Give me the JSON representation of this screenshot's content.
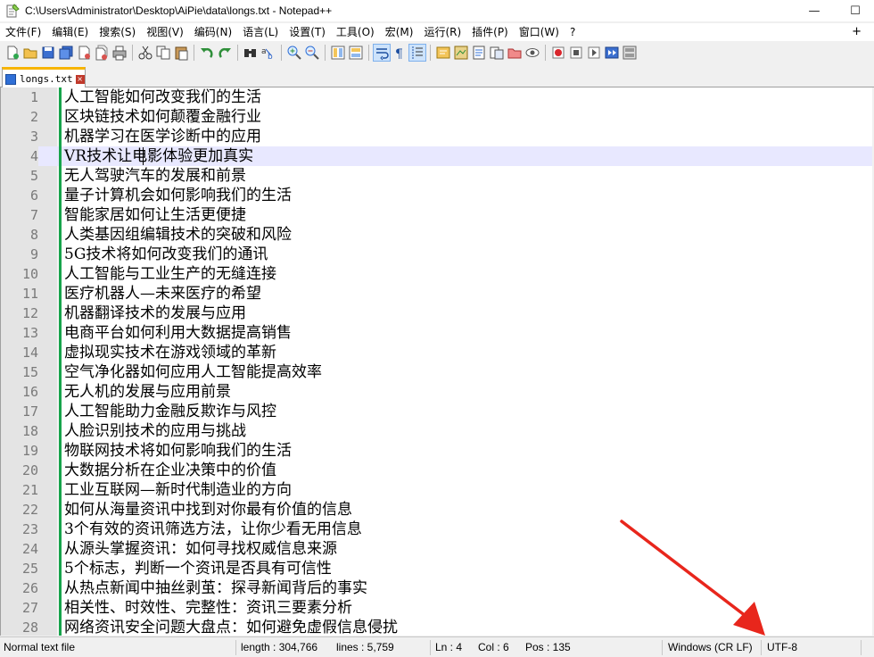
{
  "window": {
    "title": "C:\\Users\\Administrator\\Desktop\\AiPie\\data\\longs.txt - Notepad++",
    "minimize_glyph": "—",
    "maximize_glyph": "☐"
  },
  "menu": {
    "items": [
      "文件(F)",
      "编辑(E)",
      "搜索(S)",
      "视图(V)",
      "编码(N)",
      "语言(L)",
      "设置(T)",
      "工具(O)",
      "宏(M)",
      "运行(R)",
      "插件(P)",
      "窗口(W)",
      "?"
    ],
    "plus": "+"
  },
  "toolbar": {
    "icons": [
      "new-file-icon",
      "open-file-icon",
      "save-icon",
      "save-all-icon",
      "close-icon",
      "close-all-icon",
      "print-icon",
      "cut-icon",
      "copy-icon",
      "paste-icon",
      "undo-icon",
      "redo-icon",
      "find-icon",
      "replace-icon",
      "zoom-in-icon",
      "zoom-out-icon",
      "sync-vertical-icon",
      "sync-horizontal-icon",
      "word-wrap-icon",
      "show-all-chars-icon",
      "indent-guide-icon",
      "language-icon",
      "doc-map-icon",
      "function-list-icon",
      "folder-workspace-icon",
      "monitoring-icon",
      "record-macro-icon",
      "stop-macro-icon",
      "play-macro-icon",
      "run-macro-multiple-icon",
      "save-macro-icon"
    ]
  },
  "tab": {
    "label": "longs.txt",
    "close_glyph": "×"
  },
  "editor": {
    "current_line": 4,
    "lines": [
      {
        "n": "1",
        "text": "人工智能如何改变我们的生活"
      },
      {
        "n": "2",
        "text": "区块链技术如何颠覆金融行业"
      },
      {
        "n": "3",
        "text": "机器学习在医学诊断中的应用"
      },
      {
        "n": "4",
        "text": "VR技术让电影体验更加真实"
      },
      {
        "n": "5",
        "text": "无人驾驶汽车的发展和前景"
      },
      {
        "n": "6",
        "text": "量子计算机会如何影响我们的生活"
      },
      {
        "n": "7",
        "text": "智能家居如何让生活更便捷"
      },
      {
        "n": "8",
        "text": "人类基因组编辑技术的突破和风险"
      },
      {
        "n": "9",
        "text": "5G技术将如何改变我们的通讯"
      },
      {
        "n": "10",
        "text": "人工智能与工业生产的无缝连接"
      },
      {
        "n": "11",
        "text": "医疗机器人—未来医疗的希望"
      },
      {
        "n": "12",
        "text": "机器翻译技术的发展与应用"
      },
      {
        "n": "13",
        "text": "电商平台如何利用大数据提高销售"
      },
      {
        "n": "14",
        "text": "虚拟现实技术在游戏领域的革新"
      },
      {
        "n": "15",
        "text": "空气净化器如何应用人工智能提高效率"
      },
      {
        "n": "16",
        "text": "无人机的发展与应用前景"
      },
      {
        "n": "17",
        "text": "人工智能助力金融反欺诈与风控"
      },
      {
        "n": "18",
        "text": "人脸识别技术的应用与挑战"
      },
      {
        "n": "19",
        "text": "物联网技术将如何影响我们的生活"
      },
      {
        "n": "20",
        "text": "大数据分析在企业决策中的价值"
      },
      {
        "n": "21",
        "text": "工业互联网—新时代制造业的方向"
      },
      {
        "n": "22",
        "text": "如何从海量资讯中找到对你最有价值的信息"
      },
      {
        "n": "23",
        "text": "3个有效的资讯筛选方法，让你少看无用信息"
      },
      {
        "n": "24",
        "text": "从源头掌握资讯：如何寻找权威信息来源"
      },
      {
        "n": "25",
        "text": "5个标志，判断一个资讯是否具有可信性"
      },
      {
        "n": "26",
        "text": "从热点新闻中抽丝剥茧：探寻新闻背后的事实"
      },
      {
        "n": "27",
        "text": "相关性、时效性、完整性：资讯三要素分析"
      },
      {
        "n": "28",
        "text": "网络资讯安全问题大盘点：如何避免虚假信息侵扰"
      }
    ]
  },
  "status": {
    "file_type": "Normal text file",
    "length": "length : 304,766",
    "lines": "lines : 5,759",
    "ln": "Ln : 4",
    "col": "Col : 6",
    "pos": "Pos : 135",
    "eol": "Windows (CR LF)",
    "encoding": "UTF-8"
  },
  "colors": {
    "annotation_arrow": "#e8261c",
    "change_bar": "#16a34a",
    "current_line_bg": "#e8e8ff",
    "tab_accent": "#f7b400"
  }
}
